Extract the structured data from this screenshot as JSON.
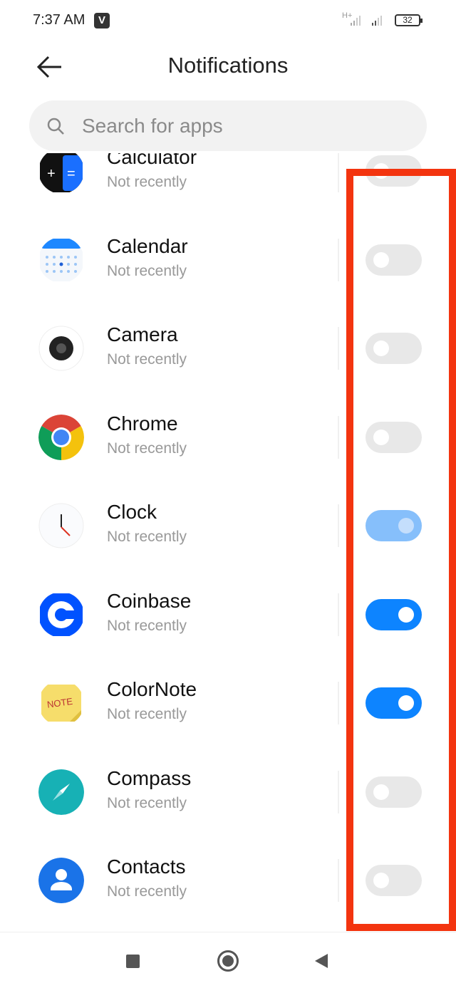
{
  "status": {
    "time": "7:37 AM",
    "app_badge": "V",
    "network": "H+",
    "battery": "32"
  },
  "header": {
    "title": "Notifications",
    "back_icon": "arrow-left-icon"
  },
  "search": {
    "placeholder": "Search for apps"
  },
  "apps": [
    {
      "name": "Calculator",
      "subtitle": "Not recently",
      "enabled": false,
      "icon": "calculator-icon"
    },
    {
      "name": "Calendar",
      "subtitle": "Not recently",
      "enabled": false,
      "icon": "calendar-icon"
    },
    {
      "name": "Camera",
      "subtitle": "Not recently",
      "enabled": false,
      "icon": "camera-icon"
    },
    {
      "name": "Chrome",
      "subtitle": "Not recently",
      "enabled": false,
      "icon": "chrome-icon"
    },
    {
      "name": "Clock",
      "subtitle": "Not recently",
      "enabled": true,
      "locked": true,
      "icon": "clock-icon"
    },
    {
      "name": "Coinbase",
      "subtitle": "Not recently",
      "enabled": true,
      "icon": "coinbase-icon"
    },
    {
      "name": "ColorNote",
      "subtitle": "Not recently",
      "enabled": true,
      "icon": "colornote-icon",
      "icon_text": "NOTE"
    },
    {
      "name": "Compass",
      "subtitle": "Not recently",
      "enabled": false,
      "icon": "compass-icon"
    },
    {
      "name": "Contacts",
      "subtitle": "Not recently",
      "enabled": false,
      "icon": "contacts-icon"
    }
  ],
  "colors": {
    "toggle_on": "#0d84ff",
    "toggle_off": "#e8e8e8",
    "highlight": "#f3340f"
  }
}
